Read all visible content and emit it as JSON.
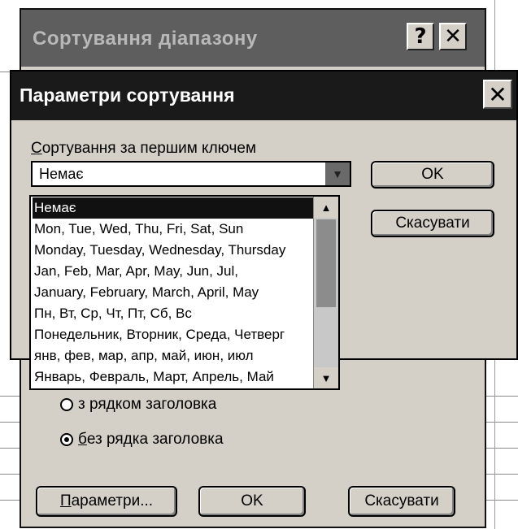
{
  "back_dialog": {
    "title": "Сортування діапазону",
    "help_icon": "?",
    "close_icon": "✕",
    "radio_with_header": "з рядком заголовка",
    "radio_without_header_u": "б",
    "radio_without_header_rest": "ез рядка заголовка",
    "params_button_u": "П",
    "params_button_rest": "араметри...",
    "ok_button": "OK",
    "cancel_button": "Скасувати"
  },
  "front_dialog": {
    "title": "Параметри сортування",
    "close_icon": "✕",
    "first_key_label_u": "С",
    "first_key_label_rest": "ортування за першим ключем",
    "combo_value": "Немає",
    "ok_button": "OK",
    "cancel_button": "Скасувати",
    "dropdown_items": [
      "Немає",
      "Mon, Tue, Wed, Thu, Fri, Sat, Sun",
      "Monday, Tuesday, Wednesday, Thursday",
      "Jan, Feb, Mar, Apr, May, Jun, Jul,",
      "January, February, March, April, May",
      "Пн, Вт, Ср, Чт, Пт, Сб, Вс",
      "Понедельник, Вторник, Среда, Четверг",
      "янв, фев, мар, апр, май, июн, июл",
      "Январь, Февраль, Март, Апрель, Май"
    ]
  },
  "colors": {
    "dialog_face": "#d4d0c8",
    "active_titlebar": "#1a1a1a",
    "inactive_titlebar": "#5e5e5e"
  }
}
